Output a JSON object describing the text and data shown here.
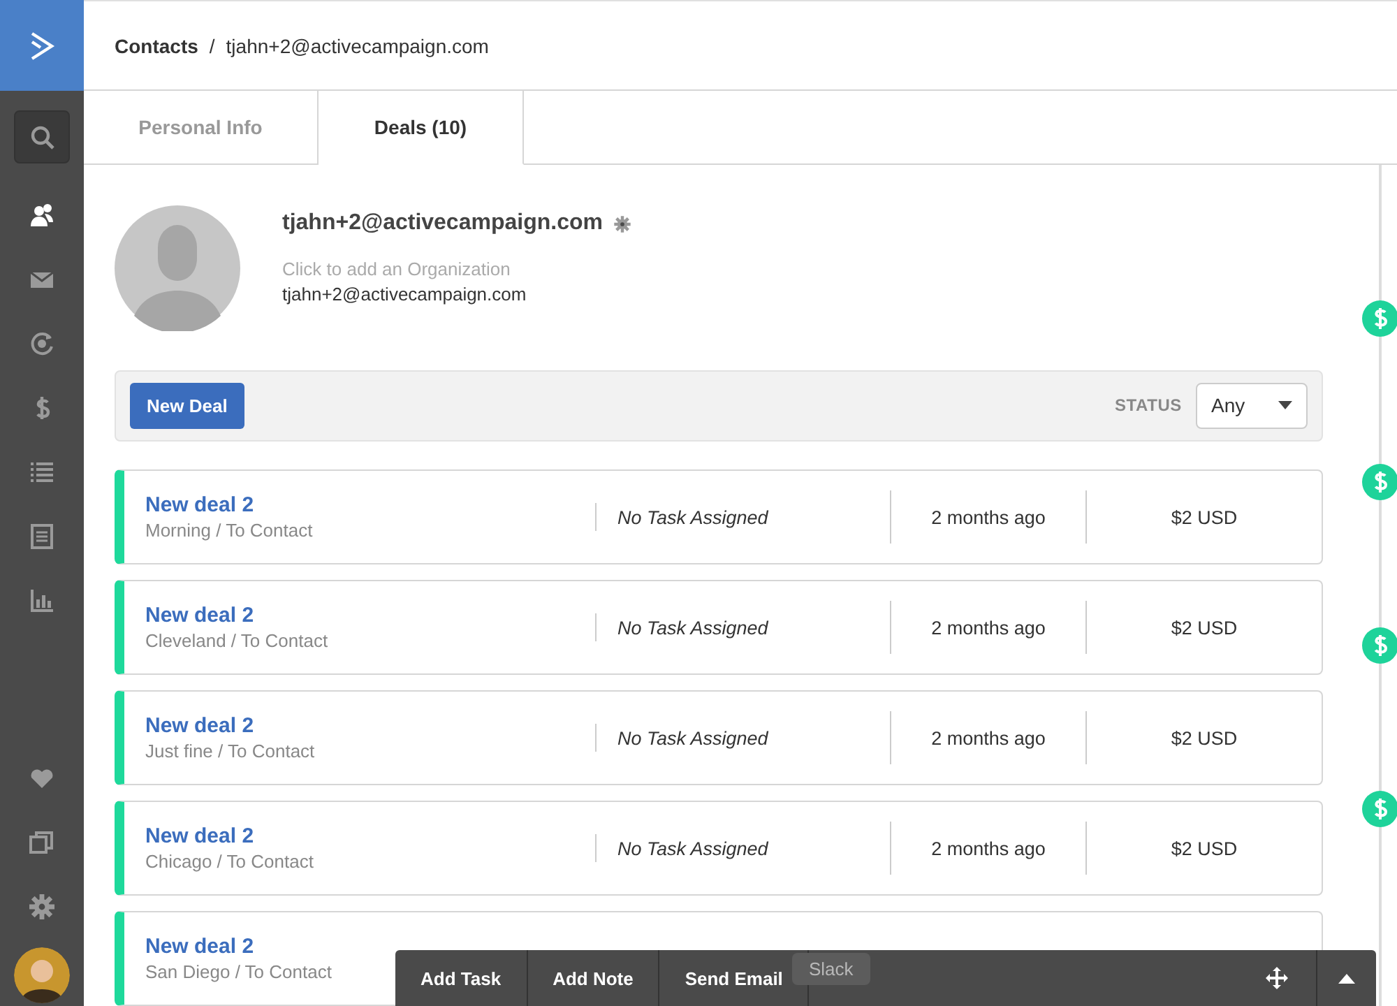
{
  "nav_items": [
    {
      "kind": "search",
      "selected": false
    },
    {
      "kind": "contacts",
      "selected": true
    },
    {
      "kind": "mail",
      "selected": false
    },
    {
      "kind": "target",
      "selected": false
    },
    {
      "kind": "dollar",
      "selected": false
    },
    {
      "kind": "list",
      "selected": false
    },
    {
      "kind": "document",
      "selected": false
    },
    {
      "kind": "chart",
      "selected": false
    }
  ],
  "nav_bottom": [
    {
      "kind": "heart"
    },
    {
      "kind": "copy"
    },
    {
      "kind": "gear"
    },
    {
      "kind": "avatar"
    }
  ],
  "breadcrumb": {
    "parent": "Contacts",
    "separator": "/",
    "current": "tjahn+2@activecampaign.com"
  },
  "tabs": [
    {
      "label": "Personal Info",
      "selected": false
    },
    {
      "label": "Deals (10)",
      "selected": true
    }
  ],
  "contact": {
    "name": "tjahn+2@activecampaign.com",
    "organization_placeholder": "Click to add an Organization",
    "email": "tjahn+2@activecampaign.com"
  },
  "deals_bar": {
    "new_button": "New Deal",
    "status_label": "STATUS",
    "status_value": "Any"
  },
  "deals": [
    {
      "title": "New deal 2",
      "subtitle": "Morning / To Contact",
      "task": "No Task Assigned",
      "time": "2 months ago",
      "amount": "$2 USD"
    },
    {
      "title": "New deal 2",
      "subtitle": "Cleveland / To Contact",
      "task": "No Task Assigned",
      "time": "2 months ago",
      "amount": "$2 USD"
    },
    {
      "title": "New deal 2",
      "subtitle": "Just fine / To Contact",
      "task": "No Task Assigned",
      "time": "2 months ago",
      "amount": "$2 USD"
    },
    {
      "title": "New deal 2",
      "subtitle": "Chicago / To Contact",
      "task": "No Task Assigned",
      "time": "2 months ago",
      "amount": "$2 USD"
    },
    {
      "title": "New deal 2",
      "subtitle": "San Diego / To Contact"
    }
  ],
  "toolbar": {
    "buttons": [
      "Add Task",
      "Add Note",
      "Send Email"
    ],
    "tooltip": "Slack"
  }
}
